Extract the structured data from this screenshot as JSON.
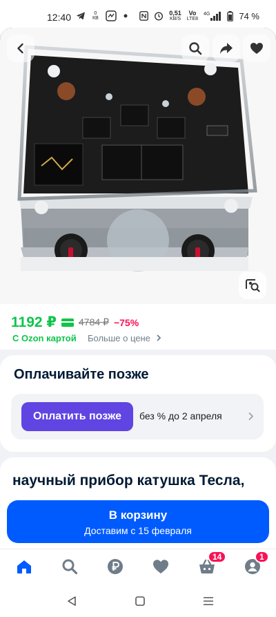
{
  "status_bar": {
    "time": "12:40",
    "data_speed_top": "0",
    "data_speed_unit": "КВ",
    "net_speed_value": "0,51",
    "net_speed_unit": "KB/S",
    "volte_top": "Vo",
    "volte_bottom": "LTE8",
    "network": "4G",
    "battery_pct": "74 %"
  },
  "product_photo": {
    "back_icon": "chevron-left-icon",
    "search_icon": "search-icon",
    "share_icon": "share-arrow-icon",
    "favorite_icon": "heart-icon",
    "lens_icon": "image-search-icon"
  },
  "price": {
    "current": "1192 ₽",
    "old": "4784 ₽",
    "discount": "−75%",
    "ozon_card_label": "С Ozon картой",
    "more_label": "Больше о цене",
    "accent_color": "#10c44c",
    "discount_color": "#f91155"
  },
  "pay_later": {
    "title": "Оплачивайте позже",
    "button_label": "Оплатить позже",
    "note": "без % до 2 апреля",
    "button_color": "#6045e2"
  },
  "product": {
    "title": "научный прибор катушка Тесла,"
  },
  "cart_button": {
    "label": "В корзину",
    "delivery": "Доставим с 15 февраля",
    "color": "#005bff"
  },
  "tab_bar": {
    "items": [
      {
        "name": "home",
        "icon": "home-icon",
        "active": true
      },
      {
        "name": "search",
        "icon": "search-icon",
        "active": false
      },
      {
        "name": "ruble",
        "icon": "ruble-icon",
        "active": false
      },
      {
        "name": "favorites",
        "icon": "heart-icon",
        "active": false
      },
      {
        "name": "cart",
        "icon": "basket-icon",
        "badge": "14",
        "active": false
      },
      {
        "name": "profile",
        "icon": "profile-icon",
        "badge": "1",
        "active": false
      }
    ]
  }
}
